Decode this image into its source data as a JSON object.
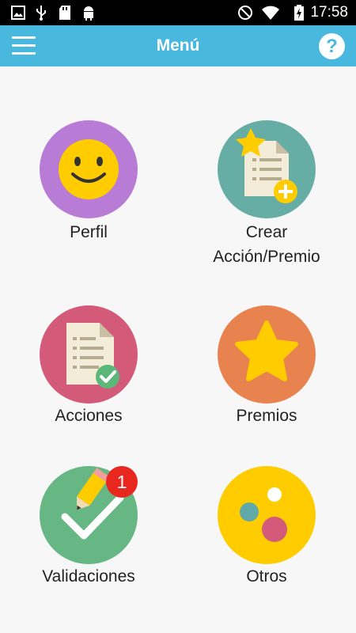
{
  "status_bar": {
    "time": "17:58",
    "left_icons": [
      "image-icon",
      "usb-icon",
      "sd-card-icon",
      "android-icon"
    ],
    "right_icons": [
      "do-not-disturb-icon",
      "wifi-icon",
      "battery-charging-icon"
    ]
  },
  "app_bar": {
    "title": "Menú",
    "menu_icon": "hamburger-menu-icon",
    "help_label": "?",
    "color": "#49b8df"
  },
  "menu": {
    "items": [
      {
        "label": "Perfil",
        "color": "#b87bd6",
        "icon": "smiley-face-icon"
      },
      {
        "label": "Crear\nAcción/Premio",
        "color": "#66ada5",
        "icon": "create-document-star-icon"
      },
      {
        "label": "Acciones",
        "color": "#d45a7a",
        "icon": "document-check-icon"
      },
      {
        "label": "Premios",
        "color": "#e8834f",
        "icon": "star-icon"
      },
      {
        "label": "Validaciones",
        "color": "#67b785",
        "icon": "pencil-check-icon",
        "badge": "1"
      },
      {
        "label": "Otros",
        "color": "#ffcc00",
        "icon": "dots-icon"
      }
    ]
  }
}
